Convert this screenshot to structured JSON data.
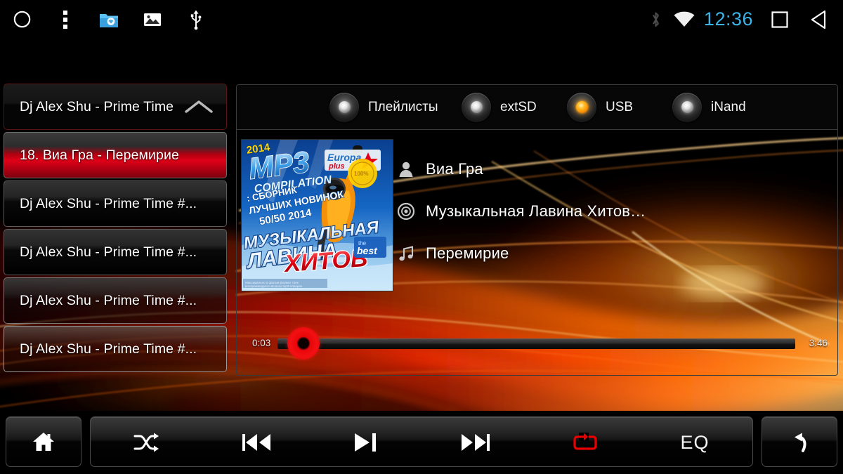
{
  "statusbar": {
    "left_icons": [
      {
        "name": "home-circle-icon",
        "label": "Home"
      },
      {
        "name": "overflow-menu-icon",
        "label": "Menu"
      },
      {
        "name": "file-manager-icon",
        "label": "File Manager"
      },
      {
        "name": "gallery-icon",
        "label": "Gallery"
      },
      {
        "name": "usb-icon",
        "label": "USB"
      }
    ],
    "right_icons": [
      {
        "name": "bluetooth-icon",
        "label": "Bluetooth"
      },
      {
        "name": "wifi-icon",
        "label": "Wi-Fi"
      }
    ],
    "clock": "12:36",
    "clock_color": "#3cb4e6",
    "nav_icons": [
      {
        "name": "recents-square-icon",
        "label": "Recents"
      },
      {
        "name": "back-triangle-icon",
        "label": "Back"
      }
    ]
  },
  "playlist": {
    "header": {
      "label": "Dj Alex Shu - Prime Time",
      "chevron": "chevron-up-icon"
    },
    "items": [
      {
        "label": "18. Виа Гра - Перемирие",
        "state": "selected"
      },
      {
        "label": "Dj Alex Shu - Prime Time #...",
        "state": "normal"
      },
      {
        "label": "Dj Alex Shu - Prime Time #...",
        "state": "normal"
      },
      {
        "label": "Dj Alex Shu - Prime Time #...",
        "state": "translucent"
      },
      {
        "label": "Dj Alex Shu - Prime Time #...",
        "state": "translucent2"
      }
    ]
  },
  "sources": [
    {
      "label": "Плейлисты",
      "active": false
    },
    {
      "label": "extSD",
      "active": false
    },
    {
      "label": "USB",
      "active": true
    },
    {
      "label": "iNand",
      "active": false
    }
  ],
  "album_art": {
    "year": "2014",
    "title_top": "MP3",
    "title_sub": "COMPILATION",
    "brand": "Europa plus",
    "line1": ": СБОРНИК",
    "line2": "ЛУЧШИХ НОВИНОК",
    "line3": "50/50 2014",
    "big1": "МУЗЫКАЛЬНАЯ",
    "big2": "ЛАВИНА",
    "big3": "ХИТОВ",
    "badge": "the best"
  },
  "track": {
    "artist": "Виа Гра",
    "artist_icon": "person-icon",
    "album": "Музыкальная Лавина Хитов…",
    "album_icon": "disc-icon",
    "title": "Перемирие",
    "title_icon": "music-note-icon"
  },
  "progress": {
    "current_time": "0:03",
    "total_time": "3:46",
    "percent": 1.3,
    "thumb_color": "#f21013"
  },
  "controls": {
    "home": {
      "label": "Home",
      "icon": "home-icon"
    },
    "shuffle": {
      "label": "Shuffle",
      "icon": "shuffle-icon"
    },
    "previous": {
      "label": "Previous",
      "icon": "previous-track-icon"
    },
    "playpause": {
      "label": "Play / Pause",
      "icon": "play-pause-icon"
    },
    "next": {
      "label": "Next",
      "icon": "next-track-icon"
    },
    "repeat": {
      "label": "Repeat",
      "icon": "repeat-icon",
      "active": true,
      "active_color": "#e60000"
    },
    "eq": {
      "label": "EQ",
      "icon": "equalizer-label"
    },
    "back": {
      "label": "Back",
      "icon": "back-arrow-icon"
    }
  }
}
